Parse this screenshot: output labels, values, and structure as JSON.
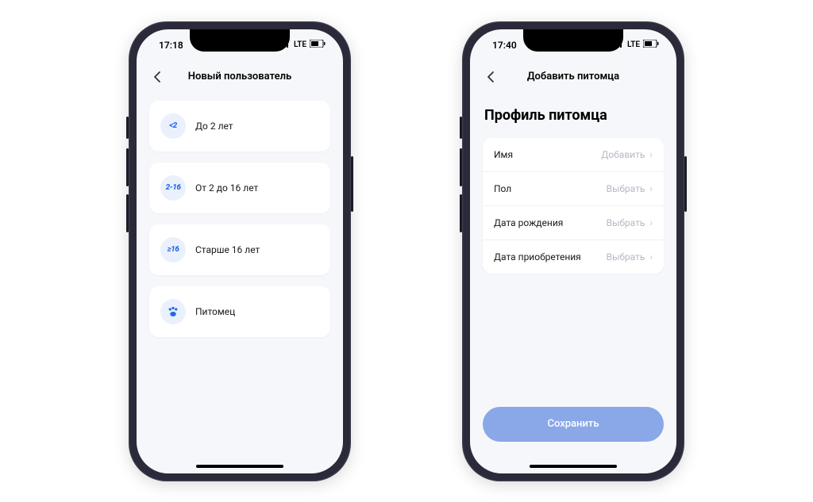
{
  "phone1": {
    "status": {
      "time": "17:18",
      "network": "LTE"
    },
    "nav": {
      "title": "Новый пользователь"
    },
    "options": [
      {
        "badge": "<2",
        "label": "До 2 лет"
      },
      {
        "badge": "2-16",
        "label": "От 2 до 16 лет"
      },
      {
        "badge": "≥16",
        "label": "Старше 16 лет"
      },
      {
        "badge": "paw",
        "label": "Питомец"
      }
    ]
  },
  "phone2": {
    "status": {
      "time": "17:40",
      "network": "LTE"
    },
    "nav": {
      "title": "Добавить питомца"
    },
    "section_title": "Профиль питомца",
    "fields": [
      {
        "label": "Имя",
        "placeholder": "Добавить"
      },
      {
        "label": "Пол",
        "placeholder": "Выбрать"
      },
      {
        "label": "Дата рождения",
        "placeholder": "Выбрать"
      },
      {
        "label": "Дата приобретения",
        "placeholder": "Выбрать"
      }
    ],
    "save_label": "Сохранить"
  }
}
